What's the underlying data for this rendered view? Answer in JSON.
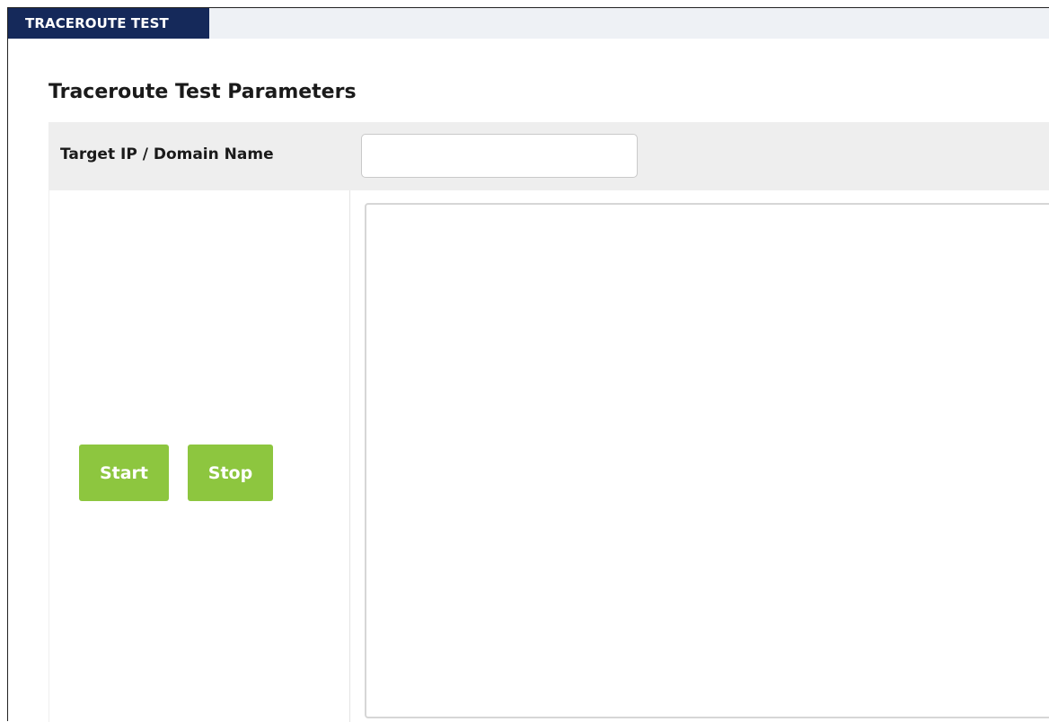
{
  "header": {
    "tab_title": "TRACEROUTE TEST"
  },
  "section": {
    "title": "Traceroute Test Parameters"
  },
  "form": {
    "target_label": "Target IP / Domain Name",
    "target_value": "",
    "target_placeholder": "",
    "output_text": ""
  },
  "buttons": {
    "start_label": "Start",
    "stop_label": "Stop"
  },
  "colors": {
    "header_bg": "#15295a",
    "button_bg": "#8dc63f",
    "row_bg": "#eeeeee"
  }
}
